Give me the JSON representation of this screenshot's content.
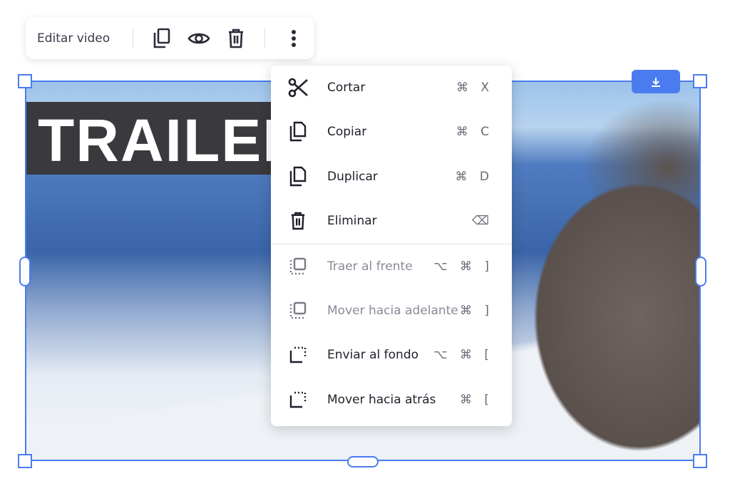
{
  "toolbar": {
    "label": "Editar video",
    "icons": [
      "copy-icon",
      "eye-icon",
      "trash-icon",
      "more-vertical-icon"
    ]
  },
  "video": {
    "title_text": "TRAILER",
    "download_icon": "download-icon"
  },
  "accent": "#4a7cf0",
  "menu": {
    "items": [
      {
        "label": "Cortar",
        "shortcut": "⌘ X",
        "icon": "scissors-icon",
        "disabled": false
      },
      {
        "label": "Copiar",
        "shortcut": "⌘ C",
        "icon": "copy-icon",
        "disabled": false
      },
      {
        "label": "Duplicar",
        "shortcut": "⌘ D",
        "icon": "duplicate-icon",
        "disabled": false
      },
      {
        "label": "Eliminar",
        "shortcut": "⌫",
        "icon": "trash-icon",
        "disabled": false
      },
      {
        "label": "Traer al frente",
        "shortcut": "⌥ ⌘ ]",
        "icon": "bring-to-front-icon",
        "disabled": true
      },
      {
        "label": "Mover hacia adelante",
        "shortcut": "⌘ ]",
        "icon": "bring-forward-icon",
        "disabled": true
      },
      {
        "label": "Enviar al fondo",
        "shortcut": "⌥ ⌘ [",
        "icon": "send-to-back-icon",
        "disabled": false
      },
      {
        "label": "Mover hacia atrás",
        "shortcut": "⌘ [",
        "icon": "send-backward-icon",
        "disabled": false
      }
    ]
  }
}
